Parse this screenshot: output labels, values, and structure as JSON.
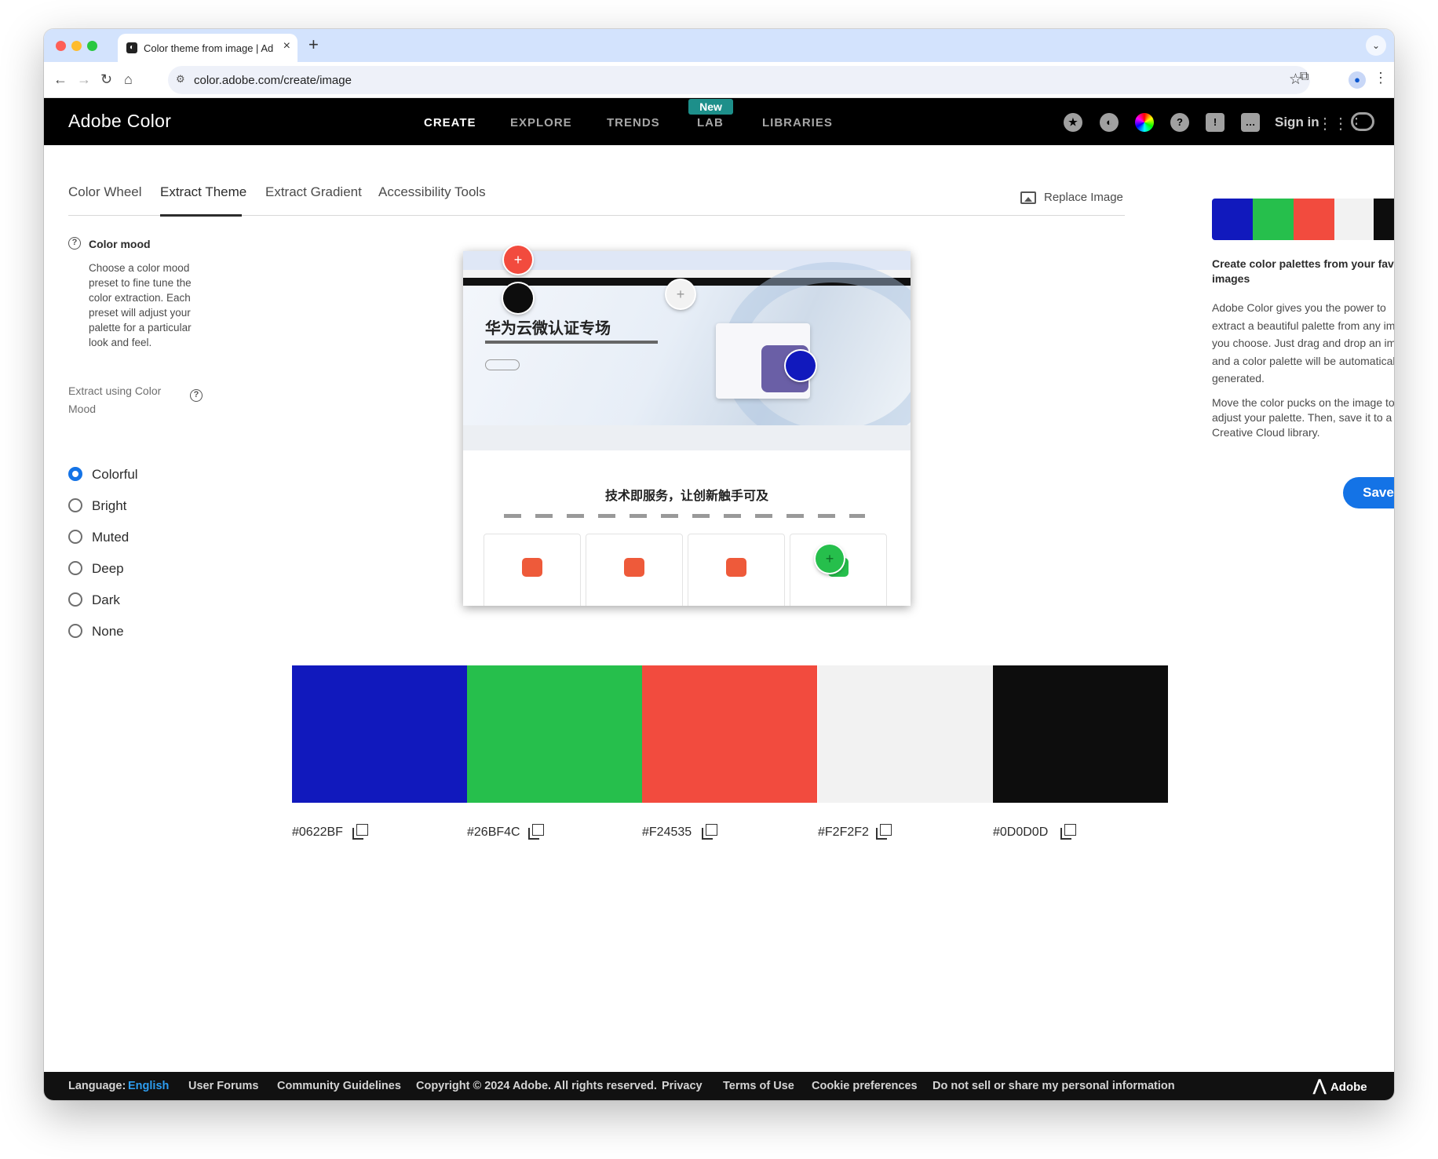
{
  "browser": {
    "tab_title": "Color theme from image | Adobe Color",
    "url": "color.adobe.com/create/image"
  },
  "brand": {
    "name": "Adobe Color"
  },
  "nav": {
    "items": [
      "CREATE",
      "EXPLORE",
      "TRENDS",
      "LAB",
      "LIBRARIES"
    ],
    "badge": "New",
    "signin": "Sign in"
  },
  "tabs": [
    "Color Wheel",
    "Extract Theme",
    "Extract Gradient",
    "Accessibility Tools"
  ],
  "replace_image": "Replace Image",
  "mood": {
    "title": "Color mood",
    "desc": "Choose a color mood preset to fine tune the color extraction. Each preset will adjust your palette for a particular look and feel.",
    "extract_label": "Extract using Color Mood",
    "options": [
      "Colorful",
      "Bright",
      "Muted",
      "Deep",
      "Dark",
      "None"
    ],
    "selected": "Colorful"
  },
  "screenshot": {
    "title": "华为云微认证专场",
    "subtitle": "技术即服务，让创新触手可及"
  },
  "palette": [
    {
      "hex": "#0622BF",
      "color": "#1119bd"
    },
    {
      "hex": "#26BF4C",
      "color": "#26bf4c"
    },
    {
      "hex": "#F24535",
      "color": "#f24b3e"
    },
    {
      "hex": "#F2F2F2",
      "color": "#f2f2f2"
    },
    {
      "hex": "#0D0D0D",
      "color": "#0d0d0d"
    }
  ],
  "right": {
    "title": "Create color palettes from your favorite images",
    "p1": "Adobe Color gives you the power to extract a beautiful palette from any image you choose. Just drag and drop an image and a color palette will be automatically generated.",
    "p2": "Move the color pucks on the image to adjust your palette. Then, save it to a Creative Cloud library.",
    "save": "Save"
  },
  "footer": {
    "language_label": "Language:",
    "language": "English",
    "links": [
      "User Forums",
      "Community Guidelines",
      "Copyright © 2024 Adobe. All rights reserved.",
      "Privacy",
      "Terms of Use",
      "Cookie preferences",
      "Do not sell or share my personal information"
    ],
    "brand": "Adobe"
  }
}
